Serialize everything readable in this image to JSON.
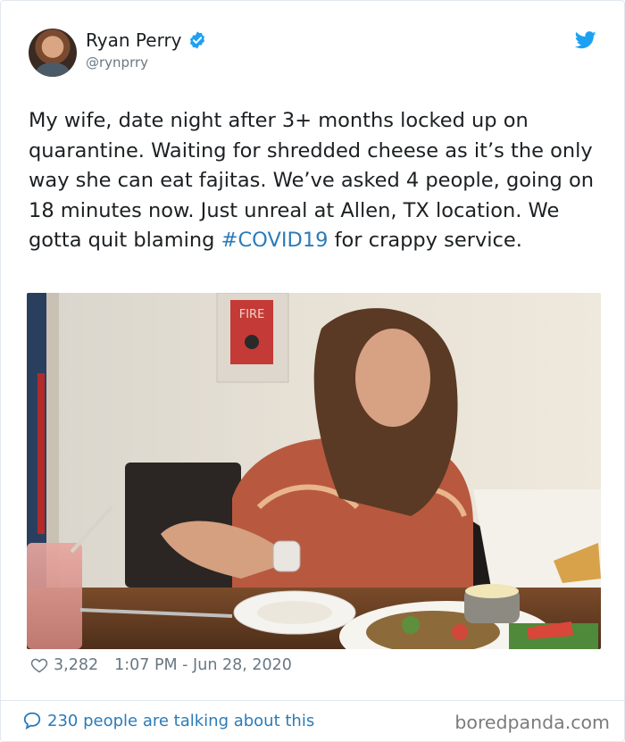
{
  "author": {
    "name": "Ryan Perry",
    "handle": "@rynprry",
    "verified": true,
    "avatar_icon": "avatar-photo"
  },
  "tweet": {
    "text_before": "My wife, date night after 3+ months locked up on quarantine. Waiting for shredded cheese as it’s the only way she can eat fajitas. We’ve asked 4 people, going on 18 minutes now. Just unreal at Allen, TX location. We gotta quit blaming ",
    "hashtag": "#COVID19",
    "text_after": " for crappy service.",
    "photo_label": "FIRE"
  },
  "meta": {
    "likes": "3,282",
    "timestamp": "1:07 PM - Jun 28, 2020"
  },
  "footer": {
    "talking": "230 people are talking about this",
    "watermark": "boredpanda.com"
  },
  "colors": {
    "link_blue": "#2b7bb9",
    "twitter_blue": "#1da1f2",
    "muted_gray": "#697882"
  }
}
